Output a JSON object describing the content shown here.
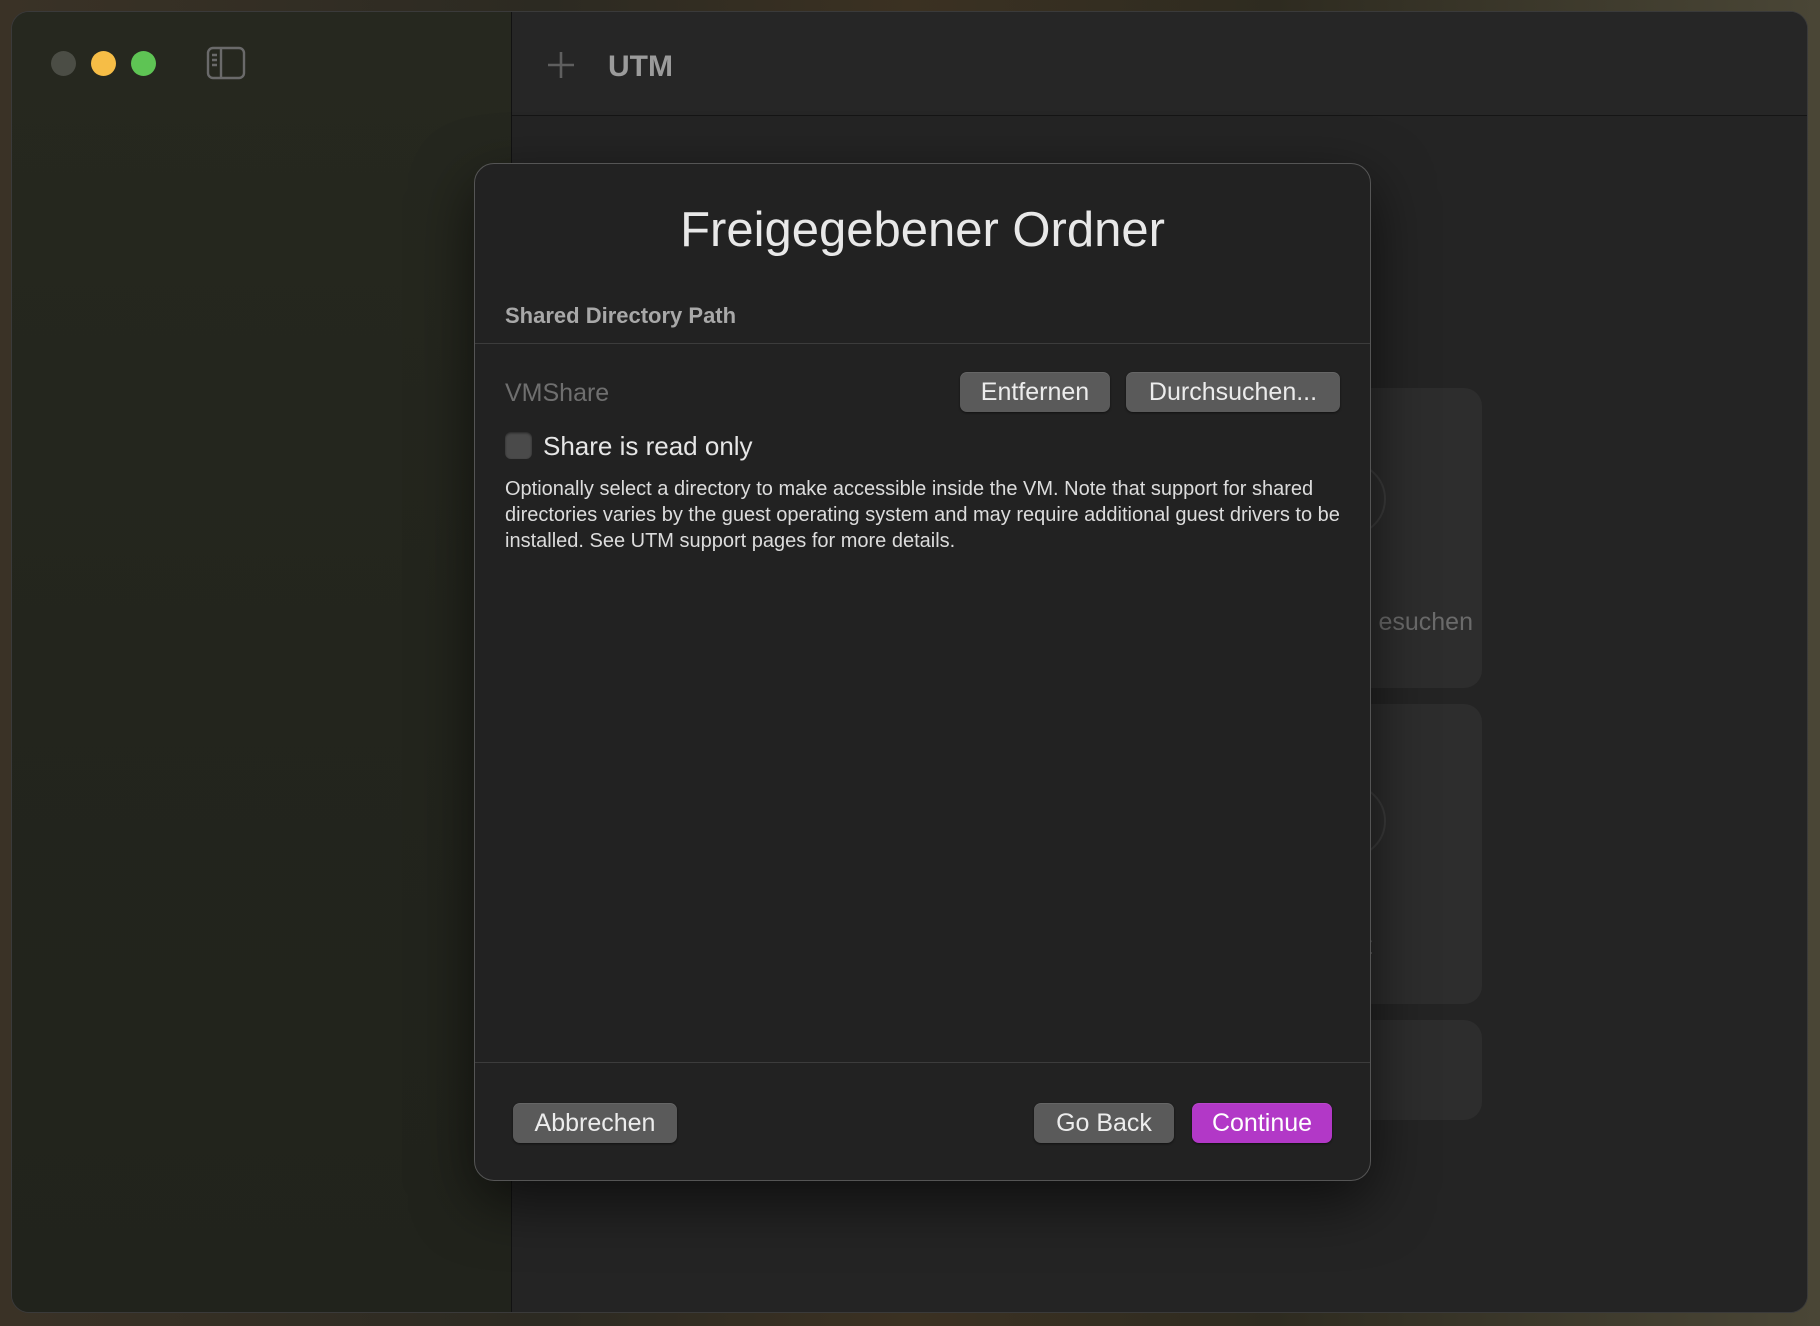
{
  "window": {
    "app_title": "UTM"
  },
  "background_cards": [
    {
      "label": "esuchen"
    },
    {
      "label": "t"
    }
  ],
  "dialog": {
    "title": "Freigegebener Ordner",
    "section_header": "Shared Directory Path",
    "path_value": "VMShare",
    "remove_label": "Entfernen",
    "browse_label": "Durchsuchen...",
    "read_only_label": "Share is read only",
    "read_only_checked": false,
    "description": "Optionally select a directory to make accessible inside the VM. Note that support for shared directories varies by the guest operating system and may require additional guest drivers to be installed. See UTM support pages for more details.",
    "cancel_label": "Abbrechen",
    "back_label": "Go Back",
    "continue_label": "Continue"
  },
  "colors": {
    "accent": "#b238c7",
    "traffic_minimize": "#f6bd46",
    "traffic_zoom": "#5ec454",
    "traffic_close_inactive": "#4b4d45"
  },
  "icons": {
    "sidebar_toggle": "sidebar-toggle-icon",
    "add": "plus-icon"
  }
}
